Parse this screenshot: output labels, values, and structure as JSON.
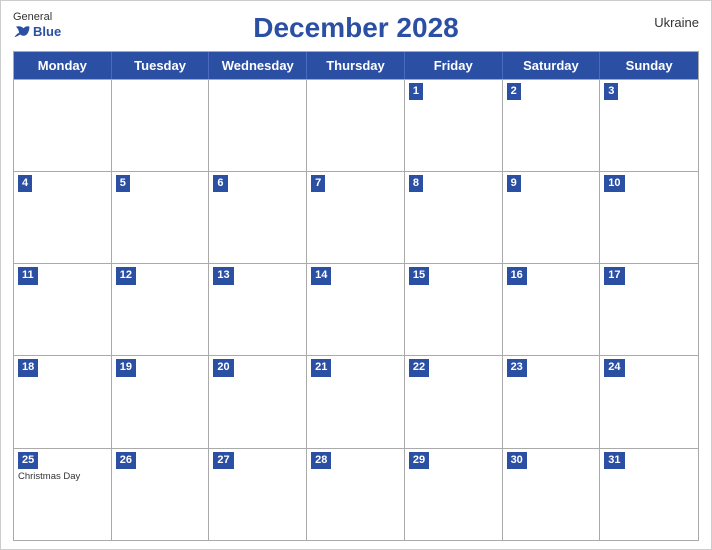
{
  "header": {
    "title": "December 2028",
    "country": "Ukraine",
    "logo_general": "General",
    "logo_blue": "Blue"
  },
  "days_of_week": [
    "Monday",
    "Tuesday",
    "Wednesday",
    "Thursday",
    "Friday",
    "Saturday",
    "Sunday"
  ],
  "weeks": [
    [
      {
        "num": "",
        "empty": true
      },
      {
        "num": "",
        "empty": true
      },
      {
        "num": "",
        "empty": true
      },
      {
        "num": "",
        "empty": true
      },
      {
        "num": "1"
      },
      {
        "num": "2"
      },
      {
        "num": "3"
      }
    ],
    [
      {
        "num": "4"
      },
      {
        "num": "5"
      },
      {
        "num": "6"
      },
      {
        "num": "7"
      },
      {
        "num": "8"
      },
      {
        "num": "9"
      },
      {
        "num": "10"
      }
    ],
    [
      {
        "num": "11"
      },
      {
        "num": "12"
      },
      {
        "num": "13"
      },
      {
        "num": "14"
      },
      {
        "num": "15"
      },
      {
        "num": "16"
      },
      {
        "num": "17"
      }
    ],
    [
      {
        "num": "18"
      },
      {
        "num": "19"
      },
      {
        "num": "20"
      },
      {
        "num": "21"
      },
      {
        "num": "22"
      },
      {
        "num": "23"
      },
      {
        "num": "24"
      }
    ],
    [
      {
        "num": "25",
        "event": "Christmas Day"
      },
      {
        "num": "26"
      },
      {
        "num": "27"
      },
      {
        "num": "28"
      },
      {
        "num": "29"
      },
      {
        "num": "30"
      },
      {
        "num": "31"
      }
    ]
  ]
}
